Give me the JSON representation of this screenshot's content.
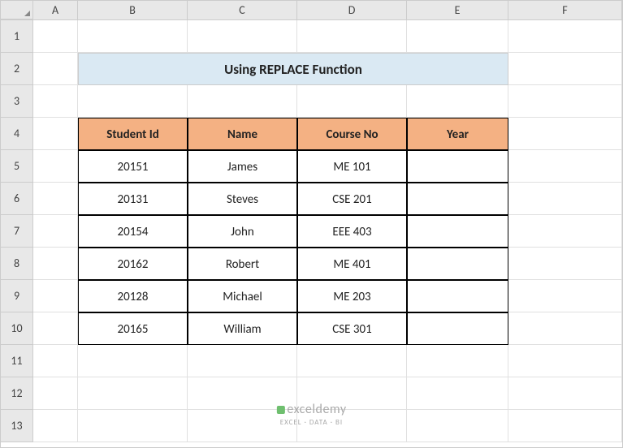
{
  "columns": [
    "A",
    "B",
    "C",
    "D",
    "E",
    "F"
  ],
  "rowNumbers": [
    "1",
    "2",
    "3",
    "4",
    "5",
    "6",
    "7",
    "8",
    "9",
    "10",
    "11",
    "12",
    "13"
  ],
  "title": "Using REPLACE Function",
  "headers": {
    "studentId": "Student Id",
    "name": "Name",
    "courseNo": "Course No",
    "year": "Year"
  },
  "rows": [
    {
      "id": "20151",
      "name": "James",
      "course": "ME 101",
      "year": ""
    },
    {
      "id": "20131",
      "name": "Steves",
      "course": "CSE 201",
      "year": ""
    },
    {
      "id": "20154",
      "name": "John",
      "course": "EEE 403",
      "year": ""
    },
    {
      "id": "20162",
      "name": "Robert",
      "course": "ME 401",
      "year": ""
    },
    {
      "id": "20128",
      "name": "Michael",
      "course": "ME 203",
      "year": ""
    },
    {
      "id": "20165",
      "name": "William",
      "course": "CSE 301",
      "year": ""
    }
  ],
  "watermark": {
    "brand": "exceldemy",
    "sub": "EXCEL · DATA · BI"
  }
}
